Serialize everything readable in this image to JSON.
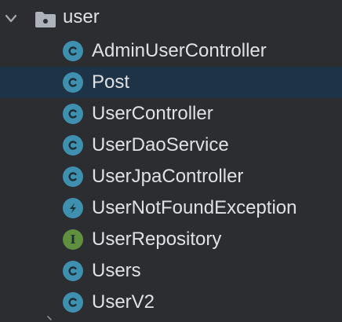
{
  "tree": {
    "folder": {
      "label": "user",
      "icon": "package-folder-icon",
      "expanded": true
    },
    "items": [
      {
        "label": "AdminUserController",
        "icon": "class-icon",
        "kind": "class",
        "selected": false
      },
      {
        "label": "Post",
        "icon": "class-icon",
        "kind": "class",
        "selected": true
      },
      {
        "label": "UserController",
        "icon": "class-icon",
        "kind": "class",
        "selected": false
      },
      {
        "label": "UserDaoService",
        "icon": "class-icon",
        "kind": "class",
        "selected": false
      },
      {
        "label": "UserJpaController",
        "icon": "class-icon",
        "kind": "class",
        "selected": false
      },
      {
        "label": "UserNotFoundException",
        "icon": "exception-class-icon",
        "kind": "exception",
        "selected": false
      },
      {
        "label": "UserRepository",
        "icon": "interface-icon",
        "kind": "interface",
        "selected": false
      },
      {
        "label": "Users",
        "icon": "class-icon",
        "kind": "class",
        "selected": false
      },
      {
        "label": "UserV2",
        "icon": "class-icon",
        "kind": "class",
        "selected": false
      }
    ]
  },
  "colors": {
    "background": "#2b2d30",
    "selection": "#1e3346",
    "class_icon": "#3f8faf",
    "interface_icon": "#5f8f3f",
    "text": "#dfe1e5"
  }
}
